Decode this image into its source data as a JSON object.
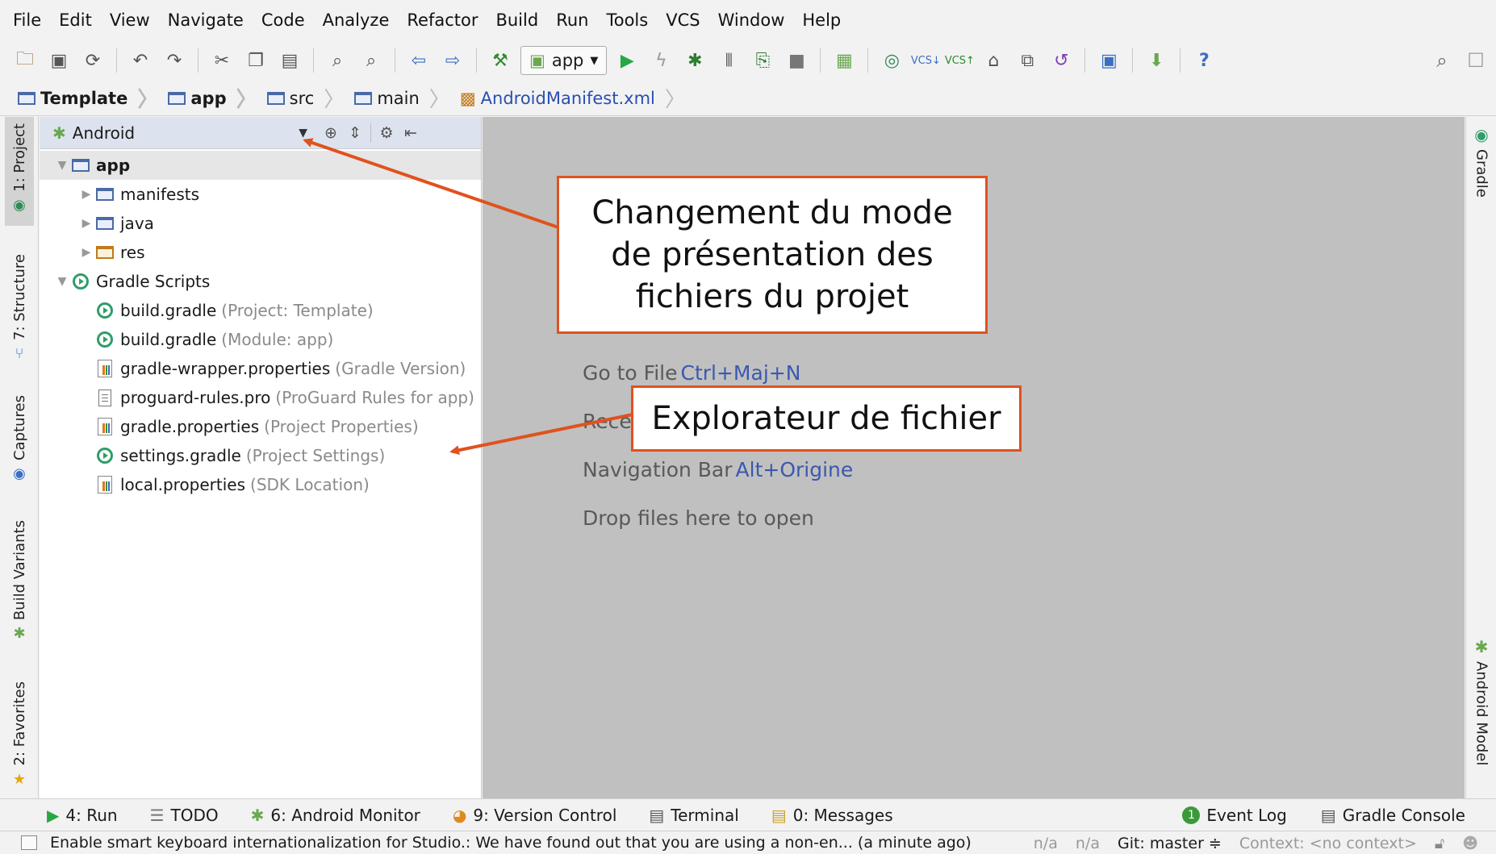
{
  "menu": [
    "File",
    "Edit",
    "View",
    "Navigate",
    "Code",
    "Analyze",
    "Refactor",
    "Build",
    "Run",
    "Tools",
    "VCS",
    "Window",
    "Help"
  ],
  "toolbar": {
    "run_config": "app"
  },
  "breadcrumb": [
    "Template",
    "app",
    "src",
    "main",
    "AndroidManifest.xml"
  ],
  "left_tabs": [
    "1: Project",
    "7: Structure",
    "Captures",
    "Build Variants",
    "2: Favorites"
  ],
  "right_tabs": [
    "Gradle",
    "Android Model"
  ],
  "project_panel": {
    "view_mode": "Android",
    "tree": [
      {
        "label": "app",
        "hint": "",
        "level": 0,
        "arrow": "▼",
        "icon": "folder-app-icon",
        "bold": true
      },
      {
        "label": "manifests",
        "hint": "",
        "level": 1,
        "arrow": "▶",
        "icon": "folder-icon"
      },
      {
        "label": "java",
        "hint": "",
        "level": 1,
        "arrow": "▶",
        "icon": "folder-icon"
      },
      {
        "label": "res",
        "hint": "",
        "level": 1,
        "arrow": "▶",
        "icon": "folder-res-icon"
      },
      {
        "label": "Gradle Scripts",
        "hint": "",
        "level": 0,
        "arrow": "▼",
        "icon": "gradle-icon"
      },
      {
        "label": "build.gradle",
        "hint": "(Project: Template)",
        "level": 1,
        "arrow": "",
        "icon": "gradle-icon"
      },
      {
        "label": "build.gradle",
        "hint": "(Module: app)",
        "level": 1,
        "arrow": "",
        "icon": "gradle-icon"
      },
      {
        "label": "gradle-wrapper.properties",
        "hint": "(Gradle Version)",
        "level": 1,
        "arrow": "",
        "icon": "properties-icon"
      },
      {
        "label": "proguard-rules.pro",
        "hint": "(ProGuard Rules for app)",
        "level": 1,
        "arrow": "",
        "icon": "document-icon"
      },
      {
        "label": "gradle.properties",
        "hint": "(Project Properties)",
        "level": 1,
        "arrow": "",
        "icon": "properties-icon"
      },
      {
        "label": "settings.gradle",
        "hint": "(Project Settings)",
        "level": 1,
        "arrow": "",
        "icon": "gradle-icon"
      },
      {
        "label": "local.properties",
        "hint": "(SDK Location)",
        "level": 1,
        "arrow": "",
        "icon": "properties-icon"
      }
    ]
  },
  "editor": {
    "go_to_file": "Go to File",
    "go_to_file_sc": "Ctrl+Maj+N",
    "recent_prefix": "Rece",
    "nav_bar": "Navigation Bar",
    "nav_bar_sc": "Alt+Origine",
    "drop": "Drop files here to open"
  },
  "callouts": {
    "mode": "Changement du mode de présentation des fichiers du projet",
    "explorer": "Explorateur de fichier"
  },
  "bottom_tabs": {
    "run": "4: Run",
    "todo": "TODO",
    "monitor": "6: Android Monitor",
    "vcs": "9: Version Control",
    "terminal": "Terminal",
    "messages": "0: Messages",
    "event_log": "Event Log",
    "event_count": "1",
    "gradle_console": "Gradle Console"
  },
  "status": {
    "message": "Enable smart keyboard internationalization for Studio.: We have found out that you are using a non-en... (a minute ago)",
    "na1": "n/a",
    "na2": "n/a",
    "git": "Git: master ≑",
    "context": "Context: <no context>"
  },
  "colors": {
    "accent": "#e0521e",
    "link": "#3b58b0",
    "editor_bg": "#c0c0c0",
    "panel_header": "#dde3ee"
  }
}
